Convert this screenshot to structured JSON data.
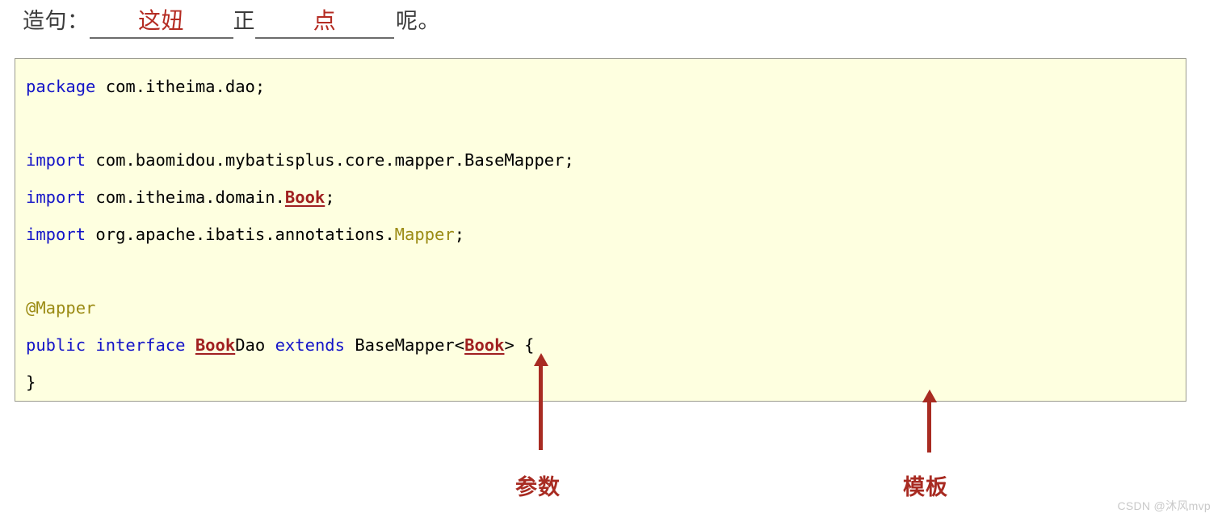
{
  "header": {
    "lead_label": "造句：",
    "blank_one_text": "这妞",
    "static_char": "正",
    "blank_two_text": "点",
    "tail_text": "呢。",
    "highlight_color": "#b42b22",
    "text_color": "#3c3c3c"
  },
  "code": {
    "background_color": "#feffe0",
    "border_color": "#9a9a8e",
    "keyword_color": "#1414c8",
    "annotation_color": "#9b8b14",
    "class_color": "#a02020",
    "plain_color": "#000000",
    "lines": [
      {
        "tokens": [
          {
            "t": "package",
            "k": "kw"
          },
          {
            "t": " com.itheima.dao;",
            "k": "plain"
          }
        ]
      },
      {
        "tokens": []
      },
      {
        "tokens": [
          {
            "t": "import",
            "k": "kw"
          },
          {
            "t": " com.baomidou.mybatisplus.core.mapper.BaseMapper;",
            "k": "plain"
          }
        ]
      },
      {
        "tokens": [
          {
            "t": "import",
            "k": "kw"
          },
          {
            "t": " com.itheima.domain.",
            "k": "plain"
          },
          {
            "t": "Book",
            "k": "cls"
          },
          {
            "t": ";",
            "k": "plain"
          }
        ]
      },
      {
        "tokens": [
          {
            "t": "import",
            "k": "kw"
          },
          {
            "t": " org.apache.ibatis.annotations.",
            "k": "plain"
          },
          {
            "t": "Mapper",
            "k": "type"
          },
          {
            "t": ";",
            "k": "plain"
          }
        ]
      },
      {
        "tokens": []
      },
      {
        "tokens": [
          {
            "t": "@Mapper",
            "k": "anno"
          }
        ]
      },
      {
        "tokens": [
          {
            "t": "public",
            "k": "kw"
          },
          {
            "t": " ",
            "k": "plain"
          },
          {
            "t": "interface",
            "k": "kw"
          },
          {
            "t": " ",
            "k": "plain"
          },
          {
            "t": "Book",
            "k": "cls"
          },
          {
            "t": "Dao ",
            "k": "plain"
          },
          {
            "t": "extends",
            "k": "kw"
          },
          {
            "t": " BaseMapper<",
            "k": "plain"
          },
          {
            "t": "Book",
            "k": "cls"
          },
          {
            "t": "> {",
            "k": "plain"
          }
        ]
      },
      {
        "tokens": [
          {
            "t": "}",
            "k": "plain"
          }
        ]
      }
    ]
  },
  "annotations": {
    "arrow_color": "#a82b22",
    "parameter_label": "参数",
    "template_label": "模板"
  },
  "watermark": {
    "text": "CSDN @沐风mvp",
    "color": "#c9c9c9"
  }
}
